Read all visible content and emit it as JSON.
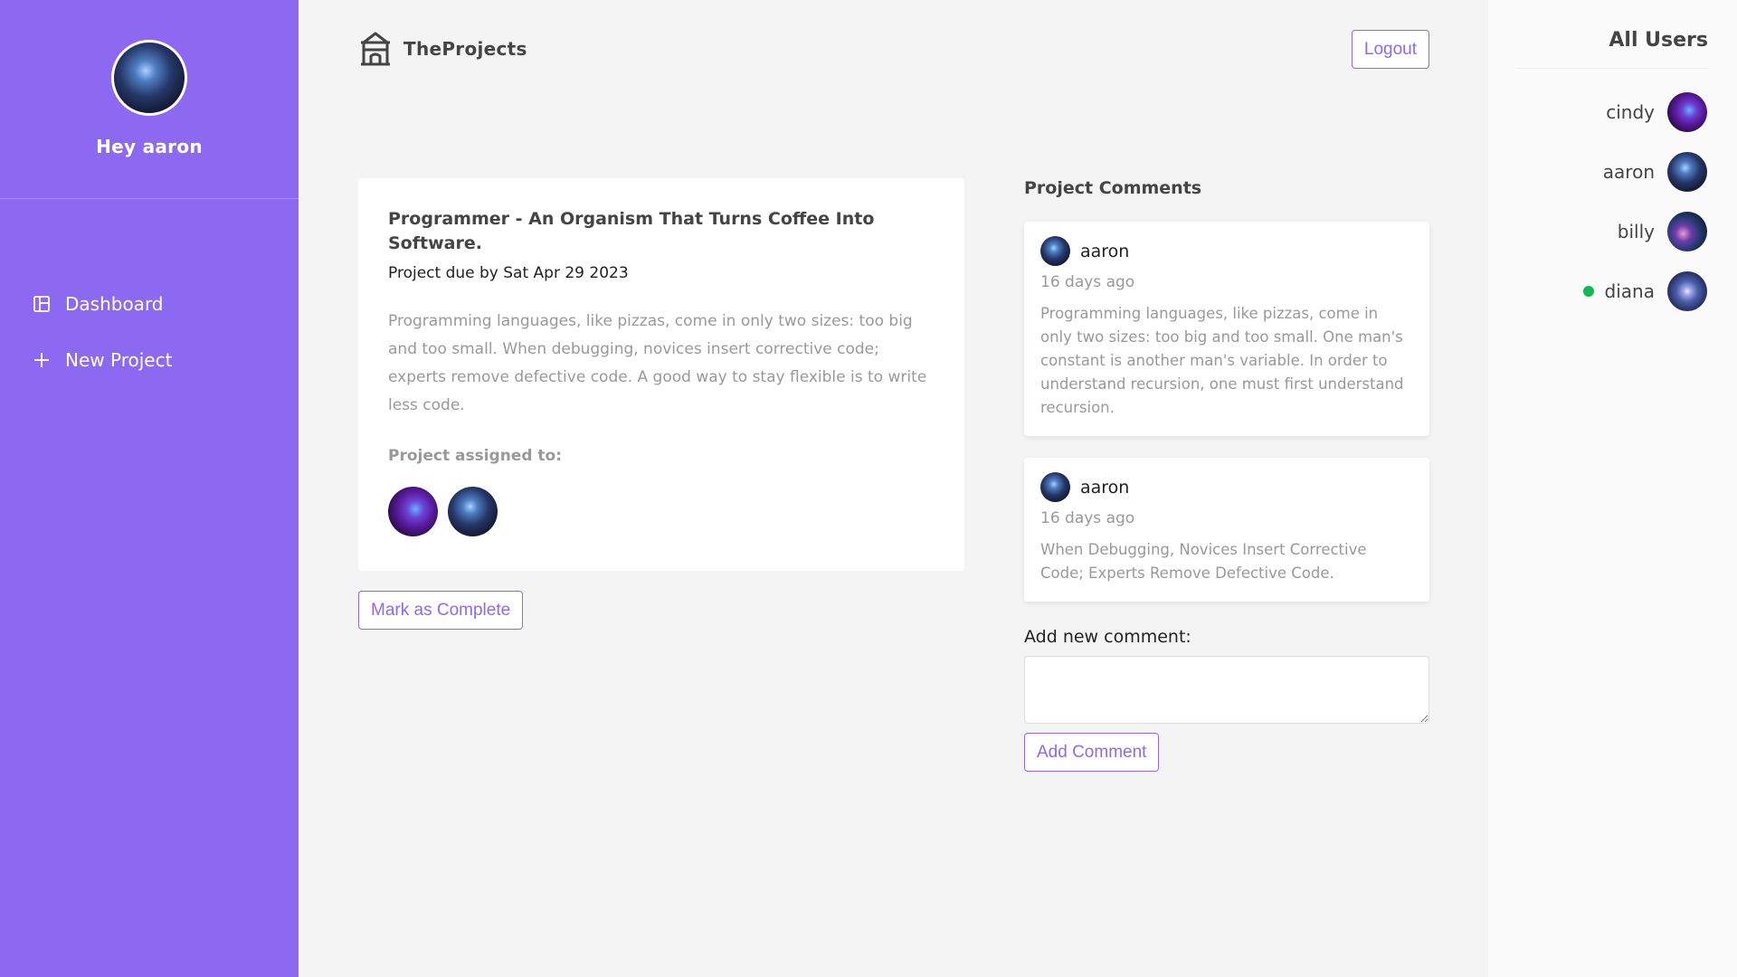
{
  "sidebar": {
    "greeting": "Hey aaron",
    "nav": [
      {
        "label": "Dashboard",
        "icon": "dashboard-icon"
      },
      {
        "label": "New Project",
        "icon": "plus-icon"
      }
    ]
  },
  "header": {
    "brand": "TheProjects",
    "logo_icon": "temple-icon",
    "logout_label": "Logout"
  },
  "project": {
    "title": "Programmer - An Organism That Turns Coffee Into Software.",
    "due": "Project due by Sat Apr 29 2023",
    "details": "Programming languages, like pizzas, come in only two sizes: too big and too small. When debugging, novices insert corrective code; experts remove defective code. A good way to stay flexible is to write less code.",
    "assigned_label": "Project assigned to:",
    "complete_label": "Mark as Complete"
  },
  "comments": {
    "heading": "Project Comments",
    "items": [
      {
        "author": "aaron",
        "date": "16 days ago",
        "content": "Programming languages, like pizzas, come in only two sizes: too big and too small. One man's constant is another man's variable. In order to understand recursion, one must first understand recursion."
      },
      {
        "author": "aaron",
        "date": "16 days ago",
        "content": "When Debugging, Novices Insert Corrective Code; Experts Remove Defective Code."
      }
    ],
    "add_label": "Add new comment:",
    "add_button": "Add Comment"
  },
  "userlist": {
    "heading": "All Users",
    "users": [
      {
        "name": "cindy",
        "online": false
      },
      {
        "name": "aaron",
        "online": false
      },
      {
        "name": "billy",
        "online": false
      },
      {
        "name": "diana",
        "online": true
      }
    ]
  },
  "colors": {
    "accent": "#8d69f1",
    "online": "#0ebb50",
    "background": "#f4f4f4"
  }
}
